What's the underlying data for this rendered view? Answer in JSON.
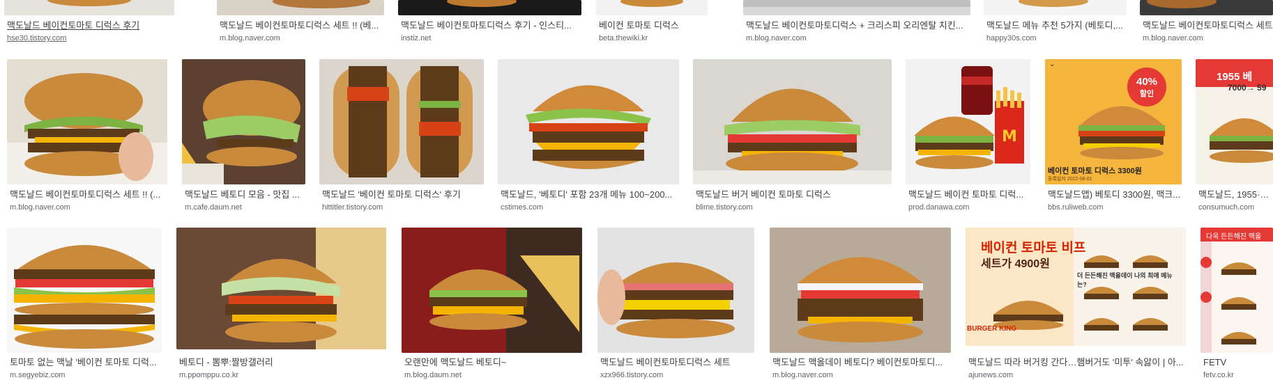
{
  "row1": [
    {
      "caption": "맥도날드 베이컨토마토 디럭스 후기",
      "source": "hse30.tistory.com"
    },
    {
      "caption": "맥도날드 베이컨토마토디럭스 세트 !! (베...",
      "source": "m.blog.naver.com"
    },
    {
      "caption": "맥도날드 베이컨토마토디럭스 후기 - 인스티...",
      "source": "instiz.net"
    },
    {
      "caption": "베이컨 토마토 디럭스",
      "source": "beta.thewiki.kr"
    },
    {
      "caption": "맥도날드 베이컨토마토디럭스 + 크리스피 오리엔탈 치킨...",
      "source": "m.blog.naver.com"
    },
    {
      "caption": "맥도날드 메뉴 추천 5가지 (베토디,...",
      "source": "happy30s.com"
    },
    {
      "caption": "맥도날드 베이컨토마토디럭스 세트",
      "source": "m.blog.naver.com"
    }
  ],
  "row2": [
    {
      "caption": "맥도날드 베이컨토마토디럭스 세트 !! (...",
      "source": "m.blog.naver.com"
    },
    {
      "caption": "맥도날드 베토디 모음 - 맛집 ...",
      "source": "m.cafe.daum.net"
    },
    {
      "caption": "맥도날드 '베이컨 토마토 디럭스' 후기",
      "source": "hittitler.tistory.com"
    },
    {
      "caption": "맥도날드, '베토디' 포함 23개 메뉴 100~200...",
      "source": "cstimes.com"
    },
    {
      "caption": "맥도날드 버거 베이컨 토마토 디럭스",
      "source": "blime.tistory.com"
    },
    {
      "caption": "맥도날드 베이컨 토마토 디럭...",
      "source": "prod.danawa.com"
    },
    {
      "caption": "맥도날드앱) 베토디 3300원, 맥크...",
      "source": "bbs.ruliweb.com",
      "badge_pct": "40%",
      "badge_word": "할인",
      "banner": "베이컨 토마토 디럭스 3300원",
      "date": "등록일자 2022-08-01"
    },
    {
      "caption": "맥도날드, 1955·베...",
      "source": "consumuch.com",
      "price_a": "1955 베",
      "price_b": "7000→ 59"
    }
  ],
  "row3": [
    {
      "caption": "토마토 없는 맥날 '베이컨 토마토 디럭...",
      "source": "m.segyebiz.com"
    },
    {
      "caption": "베토디 - 뽐뿌:짤방갤러리",
      "source": "m.ppomppu.co.kr"
    },
    {
      "caption": "오랜만에 맥도날드 베토디~",
      "source": "m.blog.daum.net"
    },
    {
      "caption": "맥도날드 베이컨토마토디럭스 세트",
      "source": "xzx966.tistory.com"
    },
    {
      "caption": "맥도날드 맥올데이 베토디? 베이컨토마토디...",
      "source": "m.blog.naver.com"
    },
    {
      "caption": "맥도날드 따라 버거킹 간다…햄버거도 '미투' 속앓이 | 아...",
      "source": "ajunews.com",
      "headline_a": "베이컨 토마토 비프",
      "headline_b": "세트가 4900원",
      "brand": "BURGER KING",
      "sub": "더 든든해진 맥올데이 나의 최애 메뉴는?"
    },
    {
      "caption": "FETV",
      "source": "fetv.co.kr",
      "sale": "다욱 든든해진 맥올"
    }
  ],
  "colors": {
    "caption": "#3c4043",
    "source": "#5f6368",
    "bun": "#c98a3c",
    "lettuce": "#7cb342",
    "tomato": "#d84315",
    "cheese": "#f4b400",
    "patty": "#5d3a1a",
    "promo_yellow": "#f5b43c",
    "promo_red": "#e53935"
  }
}
